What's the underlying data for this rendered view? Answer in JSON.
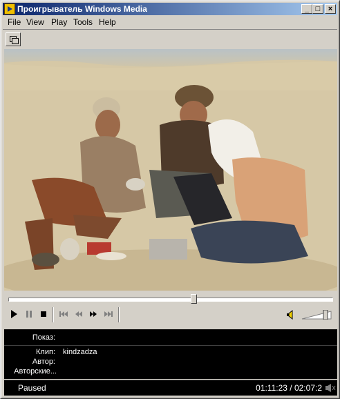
{
  "window": {
    "title": "Проигрыватель Windows Media"
  },
  "menu": [
    "File",
    "View",
    "Play",
    "Tools",
    "Help"
  ],
  "toolbar": {
    "mini_icon": "compact-mode-icon"
  },
  "playback": {
    "seek_fraction": 0.57,
    "volume_fraction": 0.85
  },
  "info": {
    "show_label": "Показ:",
    "show_value": "",
    "clip_label": "Клип:",
    "clip_value": "kindzadza",
    "author_label": "Автор:",
    "author_value": "",
    "copyright_label": "Авторские...",
    "copyright_value": ""
  },
  "status": {
    "state": "Paused",
    "time": "01:11:23 / 02:07:2"
  },
  "colors": {
    "title_start": "#0a246a",
    "title_end": "#a6caf0"
  }
}
